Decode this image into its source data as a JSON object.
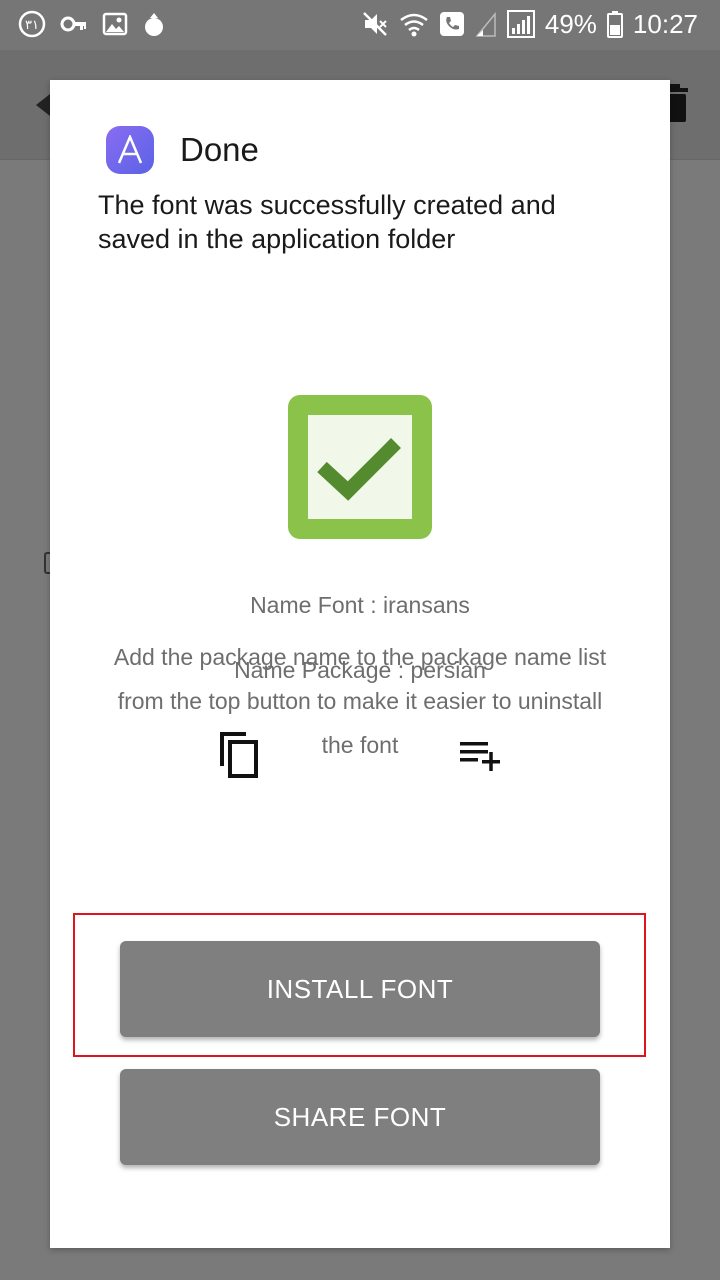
{
  "status_bar": {
    "left_icons": [
      "persian-31-notification-icon",
      "key-icon",
      "image-icon",
      "pomegranate-icon"
    ],
    "left_badge": "۳۱",
    "right_icons": [
      "mute-icon",
      "wifi-call-icon",
      "phone-icon",
      "signal-weak-icon",
      "signal-icon",
      "battery-icon"
    ],
    "battery": "49%",
    "time": "10:27"
  },
  "dialog": {
    "app_icon": "app-logo-letter-a",
    "title": "Done",
    "message": "The font was successfully created and saved in the application folder",
    "success_icon": "check-box-icon",
    "name_font": "Name Font : iransans",
    "name_package": "Name Package : persian",
    "hint": "Add the package name to the package name list from the top button to make it easier to uninstall the font",
    "install_label": "INSTALL FONT",
    "share_label": "SHARE FONT"
  },
  "colors": {
    "overlay": "#7a7a7a",
    "button": "#7f7f7f",
    "success_green": "#8bc34a",
    "highlight": "#e0141d"
  }
}
